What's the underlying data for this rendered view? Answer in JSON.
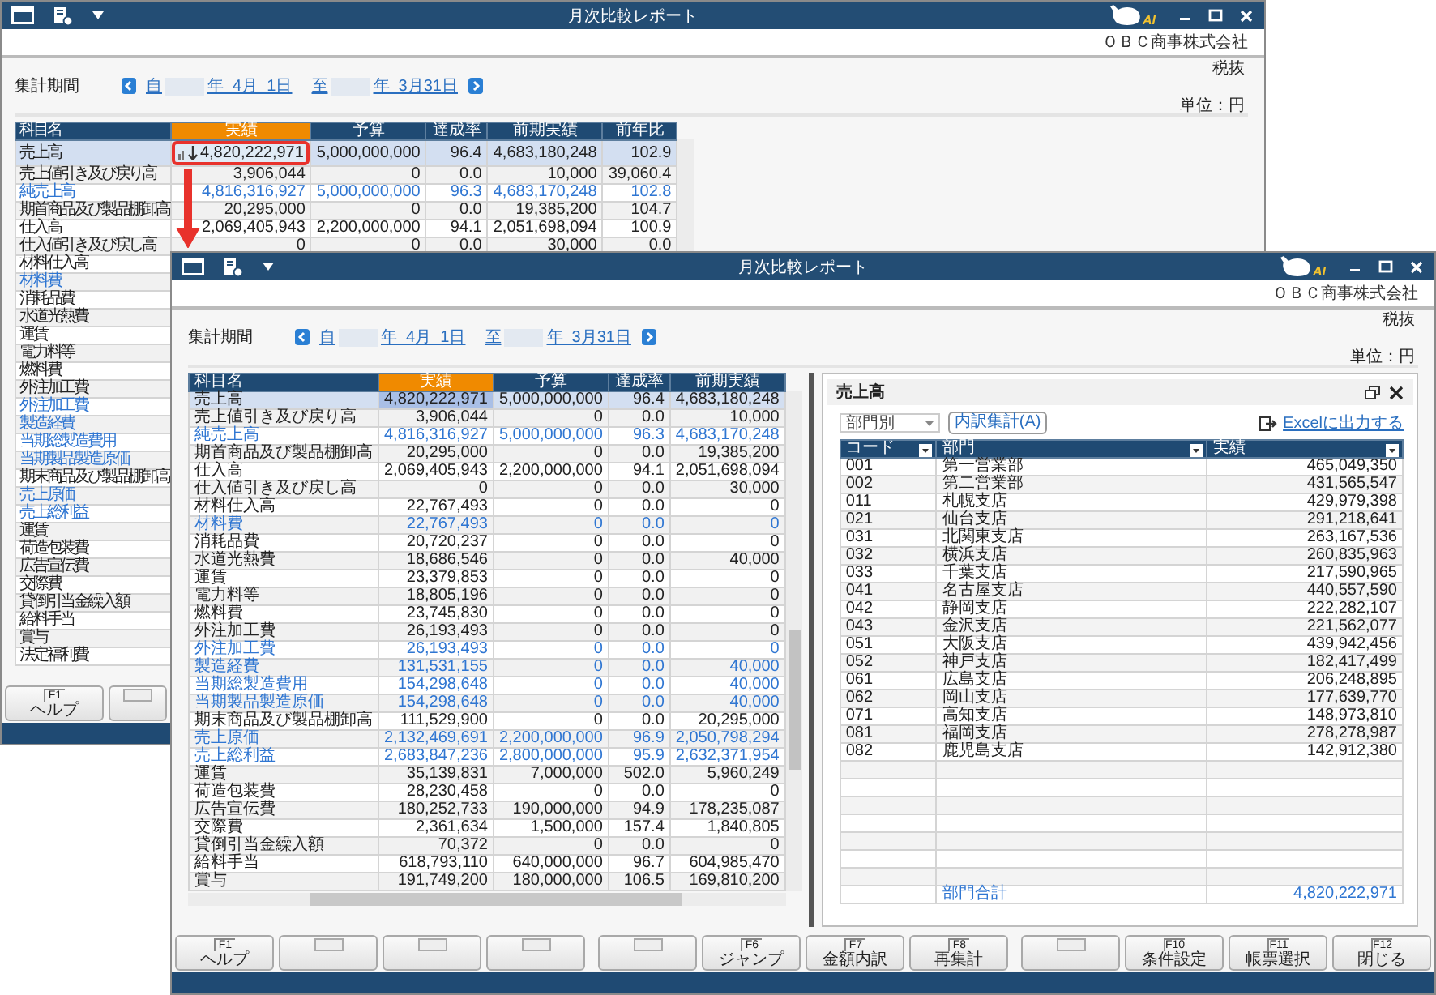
{
  "windows": [
    {
      "kind": "back",
      "title": "月次比較レポート",
      "logo_text": "AI",
      "company": "ＯＢＣ商事株式会社",
      "tax": "税抜",
      "unit": "単位：円",
      "period": {
        "label": "集計期間",
        "from_prefix": "自",
        "from_date": "年  4月  1日",
        "to_prefix": "至",
        "to_date": "年  3月31日"
      },
      "table": {
        "columns": [
          {
            "label": "科目名",
            "selected": false
          },
          {
            "label": "実績",
            "selected": true
          },
          {
            "label": "予算",
            "selected": false
          },
          {
            "label": "達成率",
            "selected": false
          },
          {
            "label": "前期実績",
            "selected": false
          },
          {
            "label": "前年比",
            "selected": false
          }
        ],
        "rows": [
          {
            "cells": [
              "売上高",
              "4,820,222,971",
              "5,000,000,000",
              "96.4",
              "4,683,180,248",
              "102.9"
            ],
            "selected": true,
            "subtotal": false,
            "drilldown": true
          },
          {
            "cells": [
              "売上値引き及び戻り高",
              "3,906,044",
              "0",
              "0.0",
              "10,000",
              "39,060.4"
            ],
            "selected": false,
            "subtotal": false
          },
          {
            "cells": [
              "純売上高",
              "4,816,316,927",
              "5,000,000,000",
              "96.3",
              "4,683,170,248",
              "102.8"
            ],
            "selected": false,
            "subtotal": true
          },
          {
            "cells": [
              "期首商品及び製品棚卸高",
              "20,295,000",
              "0",
              "0.0",
              "19,385,200",
              "104.7"
            ],
            "selected": false,
            "subtotal": false
          },
          {
            "cells": [
              "仕入高",
              "2,069,405,943",
              "2,200,000,000",
              "94.1",
              "2,051,698,094",
              "100.9"
            ],
            "selected": false,
            "subtotal": false
          },
          {
            "cells": [
              "仕入値引き及び戻し高",
              "0",
              "0",
              "0.0",
              "30,000",
              "0.0"
            ],
            "selected": false,
            "subtotal": false
          },
          {
            "cells": [
              "材料仕入高"
            ],
            "selected": false,
            "subtotal": false
          },
          {
            "cells": [
              "材料費"
            ],
            "selected": false,
            "subtotal": true
          },
          {
            "cells": [
              "消耗品費"
            ],
            "selected": false,
            "subtotal": false
          },
          {
            "cells": [
              "水道光熱費"
            ],
            "selected": false,
            "subtotal": false
          },
          {
            "cells": [
              "運賃"
            ],
            "selected": false,
            "subtotal": false
          },
          {
            "cells": [
              "電力料等"
            ],
            "selected": false,
            "subtotal": false
          },
          {
            "cells": [
              "燃料費"
            ],
            "selected": false,
            "subtotal": false
          },
          {
            "cells": [
              "外注加工費"
            ],
            "selected": false,
            "subtotal": false
          },
          {
            "cells": [
              "外注加工費"
            ],
            "selected": false,
            "subtotal": true
          },
          {
            "cells": [
              "製造経費"
            ],
            "selected": false,
            "subtotal": true
          },
          {
            "cells": [
              "当期総製造費用"
            ],
            "selected": false,
            "subtotal": true
          },
          {
            "cells": [
              "当期製品製造原価"
            ],
            "selected": false,
            "subtotal": true
          },
          {
            "cells": [
              "期末商品及び製品棚卸高"
            ],
            "selected": false,
            "subtotal": false
          },
          {
            "cells": [
              "売上原価"
            ],
            "selected": false,
            "subtotal": true
          },
          {
            "cells": [
              "売上総利益"
            ],
            "selected": false,
            "subtotal": true
          },
          {
            "cells": [
              "運賃"
            ],
            "selected": false,
            "subtotal": false
          },
          {
            "cells": [
              "荷造包装費"
            ],
            "selected": false,
            "subtotal": false
          },
          {
            "cells": [
              "広告宣伝費"
            ],
            "selected": false,
            "subtotal": false
          },
          {
            "cells": [
              "交際費"
            ],
            "selected": false,
            "subtotal": false
          },
          {
            "cells": [
              "貸倒引当金繰入額"
            ],
            "selected": false,
            "subtotal": false
          },
          {
            "cells": [
              "給料手当"
            ],
            "selected": false,
            "subtotal": false
          },
          {
            "cells": [
              "賞与"
            ],
            "selected": false,
            "subtotal": false
          },
          {
            "cells": [
              "法定福利費"
            ],
            "selected": false,
            "subtotal": false
          }
        ]
      },
      "function_keys": [
        {
          "kind": "key",
          "key": "F1",
          "label": "ヘルプ"
        },
        {
          "kind": "blank"
        }
      ]
    },
    {
      "kind": "front",
      "title": "月次比較レポート",
      "logo_text": "AI",
      "company": "ＯＢＣ商事株式会社",
      "tax": "税抜",
      "unit": "単位：円",
      "period": {
        "label": "集計期間",
        "from_prefix": "自",
        "from_date": "年  4月  1日",
        "to_prefix": "至",
        "to_date": "年  3月31日"
      },
      "table": {
        "columns": [
          {
            "label": "科目名",
            "selected": false
          },
          {
            "label": "実績",
            "selected": true
          },
          {
            "label": "予算",
            "selected": false
          },
          {
            "label": "達成率",
            "selected": false
          },
          {
            "label": "前期実績",
            "selected": false
          }
        ],
        "rows": [
          {
            "cells": [
              "売上高",
              "4,820,222,971",
              "5,000,000,000",
              "96.4",
              "4,683,180,248"
            ],
            "selected": true,
            "subtotal": false
          },
          {
            "cells": [
              "売上値引き及び戻り高",
              "3,906,044",
              "0",
              "0.0",
              "10,000"
            ],
            "selected": false,
            "subtotal": false
          },
          {
            "cells": [
              "純売上高",
              "4,816,316,927",
              "5,000,000,000",
              "96.3",
              "4,683,170,248"
            ],
            "selected": false,
            "subtotal": true
          },
          {
            "cells": [
              "期首商品及び製品棚卸高",
              "20,295,000",
              "0",
              "0.0",
              "19,385,200"
            ],
            "selected": false,
            "subtotal": false
          },
          {
            "cells": [
              "仕入高",
              "2,069,405,943",
              "2,200,000,000",
              "94.1",
              "2,051,698,094"
            ],
            "selected": false,
            "subtotal": false
          },
          {
            "cells": [
              "仕入値引き及び戻し高",
              "0",
              "0",
              "0.0",
              "30,000"
            ],
            "selected": false,
            "subtotal": false
          },
          {
            "cells": [
              "材料仕入高",
              "22,767,493",
              "0",
              "0.0",
              "0"
            ],
            "selected": false,
            "subtotal": false
          },
          {
            "cells": [
              "材料費",
              "22,767,493",
              "0",
              "0.0",
              "0"
            ],
            "selected": false,
            "subtotal": true
          },
          {
            "cells": [
              "消耗品費",
              "20,720,237",
              "0",
              "0.0",
              "0"
            ],
            "selected": false,
            "subtotal": false
          },
          {
            "cells": [
              "水道光熱費",
              "18,686,546",
              "0",
              "0.0",
              "40,000"
            ],
            "selected": false,
            "subtotal": false
          },
          {
            "cells": [
              "運賃",
              "23,379,853",
              "0",
              "0.0",
              "0"
            ],
            "selected": false,
            "subtotal": false
          },
          {
            "cells": [
              "電力料等",
              "18,805,196",
              "0",
              "0.0",
              "0"
            ],
            "selected": false,
            "subtotal": false
          },
          {
            "cells": [
              "燃料費",
              "23,745,830",
              "0",
              "0.0",
              "0"
            ],
            "selected": false,
            "subtotal": false
          },
          {
            "cells": [
              "外注加工費",
              "26,193,493",
              "0",
              "0.0",
              "0"
            ],
            "selected": false,
            "subtotal": false
          },
          {
            "cells": [
              "外注加工費",
              "26,193,493",
              "0",
              "0.0",
              "0"
            ],
            "selected": false,
            "subtotal": true
          },
          {
            "cells": [
              "製造経費",
              "131,531,155",
              "0",
              "0.0",
              "40,000"
            ],
            "selected": false,
            "subtotal": true
          },
          {
            "cells": [
              "当期総製造費用",
              "154,298,648",
              "0",
              "0.0",
              "40,000"
            ],
            "selected": false,
            "subtotal": true
          },
          {
            "cells": [
              "当期製品製造原価",
              "154,298,648",
              "0",
              "0.0",
              "40,000"
            ],
            "selected": false,
            "subtotal": true
          },
          {
            "cells": [
              "期末商品及び製品棚卸高",
              "111,529,900",
              "0",
              "0.0",
              "20,295,000"
            ],
            "selected": false,
            "subtotal": false
          },
          {
            "cells": [
              "売上原価",
              "2,132,469,691",
              "2,200,000,000",
              "96.9",
              "2,050,798,294"
            ],
            "selected": false,
            "subtotal": true
          },
          {
            "cells": [
              "売上総利益",
              "2,683,847,236",
              "2,800,000,000",
              "95.9",
              "2,632,371,954"
            ],
            "selected": false,
            "subtotal": true
          },
          {
            "cells": [
              "運賃",
              "35,139,831",
              "7,000,000",
              "502.0",
              "5,960,249"
            ],
            "selected": false,
            "subtotal": false
          },
          {
            "cells": [
              "荷造包装費",
              "28,230,458",
              "0",
              "0.0",
              "0"
            ],
            "selected": false,
            "subtotal": false
          },
          {
            "cells": [
              "広告宣伝費",
              "180,252,733",
              "190,000,000",
              "94.9",
              "178,235,087"
            ],
            "selected": false,
            "subtotal": false
          },
          {
            "cells": [
              "交際費",
              "2,361,634",
              "1,500,000",
              "157.4",
              "1,840,805"
            ],
            "selected": false,
            "subtotal": false
          },
          {
            "cells": [
              "貸倒引当金繰入額",
              "70,372",
              "0",
              "0.0",
              "0"
            ],
            "selected": false,
            "subtotal": false
          },
          {
            "cells": [
              "給料手当",
              "618,793,110",
              "640,000,000",
              "96.7",
              "604,985,470"
            ],
            "selected": false,
            "subtotal": false
          },
          {
            "cells": [
              "賞与",
              "191,749,200",
              "180,000,000",
              "106.5",
              "169,810,200"
            ],
            "selected": false,
            "subtotal": false
          }
        ]
      },
      "detail_panel": {
        "title": "売上高",
        "breakdown": "部門別",
        "tally_button": "内訳集計(A)",
        "export_link": "Excelに出力する",
        "columns": [
          "コード",
          "部門",
          "実績"
        ],
        "rows": [
          {
            "code": "001",
            "name": "第一営業部",
            "amount": "465,049,350"
          },
          {
            "code": "002",
            "name": "第二営業部",
            "amount": "431,565,547"
          },
          {
            "code": "011",
            "name": "札幌支店",
            "amount": "429,979,398"
          },
          {
            "code": "021",
            "name": "仙台支店",
            "amount": "291,218,641"
          },
          {
            "code": "031",
            "name": "北関東支店",
            "amount": "263,167,536"
          },
          {
            "code": "032",
            "name": "横浜支店",
            "amount": "260,835,963"
          },
          {
            "code": "033",
            "name": "千葉支店",
            "amount": "217,590,965"
          },
          {
            "code": "041",
            "name": "名古屋支店",
            "amount": "440,557,590"
          },
          {
            "code": "042",
            "name": "静岡支店",
            "amount": "222,282,107"
          },
          {
            "code": "043",
            "name": "金沢支店",
            "amount": "221,562,077"
          },
          {
            "code": "051",
            "name": "大阪支店",
            "amount": "439,942,456"
          },
          {
            "code": "052",
            "name": "神戸支店",
            "amount": "182,417,499"
          },
          {
            "code": "061",
            "name": "広島支店",
            "amount": "206,248,895"
          },
          {
            "code": "062",
            "name": "岡山支店",
            "amount": "177,639,770"
          },
          {
            "code": "071",
            "name": "高知支店",
            "amount": "148,973,810"
          },
          {
            "code": "081",
            "name": "福岡支店",
            "amount": "278,278,987"
          },
          {
            "code": "082",
            "name": "鹿児島支店",
            "amount": "142,912,380"
          }
        ],
        "total": {
          "label": "部門合計",
          "amount": "4,820,222,971"
        }
      },
      "function_keys": [
        {
          "kind": "key",
          "key": "F1",
          "label": "ヘルプ"
        },
        {
          "kind": "blank"
        },
        {
          "kind": "blank"
        },
        {
          "kind": "blank"
        },
        {
          "kind": "blank"
        },
        {
          "kind": "key",
          "key": "F6",
          "label": "ジャンプ"
        },
        {
          "kind": "key",
          "key": "F7",
          "label": "金額内訳"
        },
        {
          "kind": "key",
          "key": "F8",
          "label": "再集計"
        },
        {
          "kind": "blank"
        },
        {
          "kind": "key",
          "key": "F10",
          "label": "条件設定"
        },
        {
          "kind": "key",
          "key": "F11",
          "label": "帳票選択"
        },
        {
          "kind": "key",
          "key": "F12",
          "label": "閉じる"
        }
      ]
    }
  ]
}
